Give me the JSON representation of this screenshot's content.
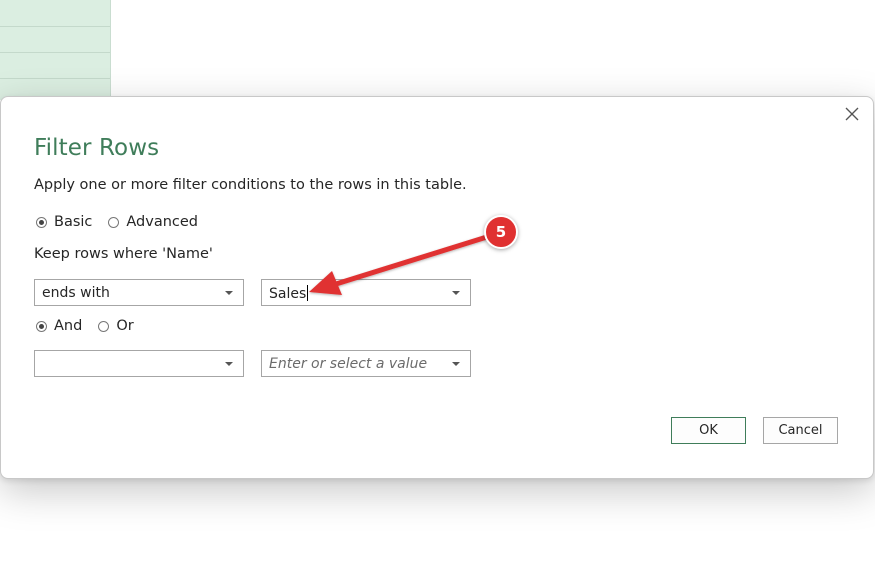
{
  "dialog": {
    "title": "Filter Rows",
    "description": "Apply one or more filter conditions to the rows in this table.",
    "close_icon": "close-icon",
    "mode_options": {
      "basic_label": "Basic",
      "advanced_label": "Advanced",
      "selected": "Basic"
    },
    "keep_rows_label": "Keep rows where 'Name'",
    "condition1": {
      "operator": "ends with",
      "value": "Sales"
    },
    "logic_options": {
      "and_label": "And",
      "or_label": "Or",
      "selected": "And"
    },
    "condition2": {
      "operator": "",
      "value_placeholder": "Enter or select a value"
    },
    "buttons": {
      "ok_label": "OK",
      "cancel_label": "Cancel"
    }
  },
  "annotation": {
    "step_number": "5",
    "color": "#e03131"
  },
  "colors": {
    "title": "#3f7d5a",
    "primary_button_border": "#3f7d5a",
    "sheet_background": "#dbeee1"
  }
}
